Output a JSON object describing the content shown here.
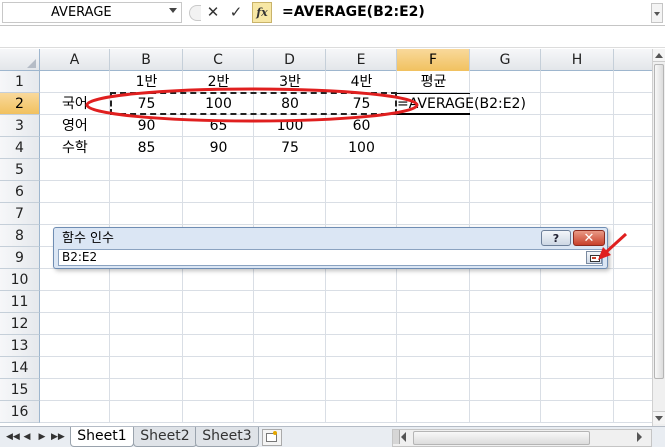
{
  "formula_bar": {
    "name_box": "AVERAGE",
    "cancel_glyph": "✕",
    "enter_glyph": "✓",
    "fx_label": "fx",
    "formula": "=AVERAGE(B2:E2)"
  },
  "columns": [
    "A",
    "B",
    "C",
    "D",
    "E",
    "F",
    "G",
    "H"
  ],
  "selected_column": "F",
  "rows": [
    "1",
    "2",
    "3",
    "4",
    "5",
    "6",
    "7",
    "8",
    "9",
    "10",
    "11",
    "12",
    "13",
    "14",
    "15",
    "16"
  ],
  "selected_row": "2",
  "cells": {
    "B1": "1반",
    "C1": "2반",
    "D1": "3반",
    "E1": "4반",
    "F1": "평균",
    "A2": "국어",
    "B2": "75",
    "C2": "100",
    "D2": "80",
    "E2": "75",
    "F2": "=AVERAGE(B2:E2)",
    "A3": "영어",
    "B3": "90",
    "C3": "65",
    "D3": "100",
    "E3": "60",
    "A4": "수학",
    "B4": "85",
    "C4": "90",
    "D4": "75",
    "E4": "100"
  },
  "dialog": {
    "title": "함수 인수",
    "help_glyph": "?",
    "close_glyph": "✕",
    "input_value": "B2:E2"
  },
  "sheet_tabs": [
    "Sheet1",
    "Sheet2",
    "Sheet3"
  ],
  "active_sheet": "Sheet1",
  "nav_glyphs": [
    "◀◀",
    "◀",
    "▶",
    "▶▶"
  ],
  "annotation_color": "#e01f1f",
  "selection_color": "#f1c15f"
}
